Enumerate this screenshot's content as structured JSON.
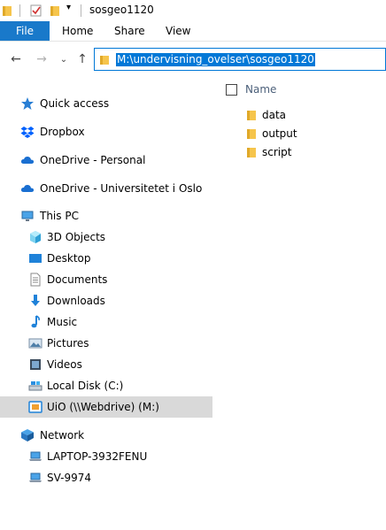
{
  "window": {
    "title": "sosgeo1120"
  },
  "ribbon": {
    "file_label": "File",
    "tabs": [
      "Home",
      "Share",
      "View"
    ]
  },
  "address": {
    "path": "M:\\undervisning_ovelser\\sosgeo1120"
  },
  "nav_pane": {
    "items": [
      {
        "label": "Quick access",
        "icon": "star-icon"
      },
      {
        "label": "Dropbox",
        "icon": "dropbox-icon"
      },
      {
        "label": "OneDrive - Personal",
        "icon": "cloud-icon"
      },
      {
        "label": "OneDrive - Universitetet i Oslo",
        "icon": "cloud-icon"
      },
      {
        "label": "This PC",
        "icon": "computer-icon"
      },
      {
        "label": "3D Objects",
        "icon": "cube-icon"
      },
      {
        "label": "Desktop",
        "icon": "desktop-icon"
      },
      {
        "label": "Documents",
        "icon": "document-icon"
      },
      {
        "label": "Downloads",
        "icon": "download-icon"
      },
      {
        "label": "Music",
        "icon": "music-icon"
      },
      {
        "label": "Pictures",
        "icon": "picture-icon"
      },
      {
        "label": "Videos",
        "icon": "video-icon"
      },
      {
        "label": "Local Disk (C:)",
        "icon": "disk-icon"
      },
      {
        "label": "UiO (\\\\Webdrive) (M:)",
        "icon": "network-drive-icon"
      },
      {
        "label": "Network",
        "icon": "network-icon"
      },
      {
        "label": "LAPTOP-3932FENU",
        "icon": "computer-icon"
      },
      {
        "label": "SV-9974",
        "icon": "computer-icon"
      }
    ]
  },
  "file_list": {
    "column_name": "Name",
    "items": [
      {
        "name": "data"
      },
      {
        "name": "output"
      },
      {
        "name": "script"
      }
    ]
  },
  "colors": {
    "accent": "#0078d7",
    "file_tab": "#1979ca",
    "folder": "#f6c54c",
    "selected_bg": "#d9d9d9"
  }
}
